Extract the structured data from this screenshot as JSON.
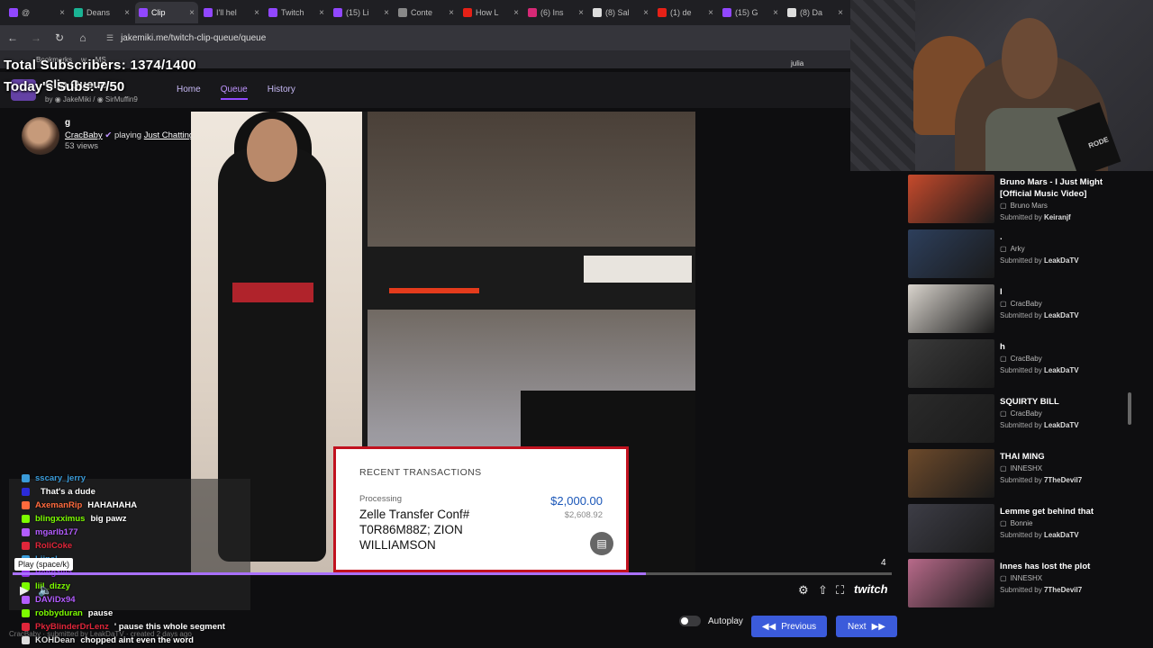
{
  "browser": {
    "tabs": [
      {
        "label": "@",
        "color": "#9147ff"
      },
      {
        "label": "Deans",
        "color": "#1ab394"
      },
      {
        "label": "Clip",
        "color": "#9147ff",
        "active": true
      },
      {
        "label": "I'll hel",
        "color": "#9147ff"
      },
      {
        "label": "Twitch",
        "color": "#9147ff"
      },
      {
        "label": "(15) Li",
        "color": "#9147ff"
      },
      {
        "label": "Conte",
        "color": "#888888"
      },
      {
        "label": "How L",
        "color": "#e62117"
      },
      {
        "label": "(6) Ins",
        "color": "#d62976"
      },
      {
        "label": "(8) Sal",
        "color": "#dddddd"
      },
      {
        "label": "(1) de",
        "color": "#e62117"
      },
      {
        "label": "(15) G",
        "color": "#9147ff"
      },
      {
        "label": "(8) Da",
        "color": "#dddddd"
      }
    ],
    "url": "jakemiki.me/twitch-clip-queue/queue",
    "bookmarks": [
      "Bookmarks",
      "w",
      "MS"
    ]
  },
  "overlay": {
    "subs": "Total Subscribers: 1374/1400",
    "today": "Today's Subs: 7/50"
  },
  "app": {
    "title": "Clip Queue",
    "by": "by",
    "authors": [
      "JakeMiki",
      "SirMuffin9"
    ],
    "nav": [
      {
        "label": "Home",
        "active": false
      },
      {
        "label": "Queue",
        "active": true
      },
      {
        "label": "History",
        "active": false
      }
    ],
    "user": "julia"
  },
  "clip": {
    "title": "g",
    "channel": "CracBaby",
    "playing": "playing",
    "game": "Just Chatting",
    "views": "53 views",
    "submitted": "CracBaby · submitted by LeakDaTV · created 2 days ago"
  },
  "transaction": {
    "heading": "RECENT TRANSACTIONS",
    "status": "Processing",
    "description": "Zelle Transfer Conf# T0R86M88Z; ZION WILLIAMSON",
    "amount": "$2,000.00",
    "balance": "$2,608.92"
  },
  "player": {
    "progress": 0.72,
    "time": "4",
    "tooltip": "Play (space/k)",
    "brand": "twitch"
  },
  "chat": [
    {
      "user": "sscary_jerry",
      "color": "#3a9bd9",
      "msg": ""
    },
    {
      "user": "",
      "color": "#2b2bd9",
      "msg": "That's a dude"
    },
    {
      "user": "AxemanRip",
      "color": "#ff6a3d",
      "msg": "HAHAHAHA"
    },
    {
      "user": "blingxximus",
      "color": "#7cfc00",
      "msg": "big pawz"
    },
    {
      "user": "mgarlb177",
      "color": "#b35cff",
      "msg": ""
    },
    {
      "user": "RoliCoke",
      "color": "#e0263a",
      "msg": ""
    },
    {
      "user": "Liinel",
      "color": "#3a9bd9",
      "msg": ""
    },
    {
      "user": "Pengzilla",
      "color": "#8a2be2",
      "msg": ""
    },
    {
      "user": "liil_dizzy",
      "color": "#7cfc00",
      "msg": ""
    },
    {
      "user": "DAViDx94",
      "color": "#b35cff",
      "msg": ""
    },
    {
      "user": "robbyduran",
      "color": "#7cfc00",
      "msg": "pause"
    },
    {
      "user": "PkyBlinderDrLenz",
      "color": "#e0263a",
      "msg": "' pause this whole segment"
    },
    {
      "user": "KOHDean",
      "color": "#dddddd",
      "msg": "chopped aint even the word"
    }
  ],
  "controls": {
    "autoplay": "Autoplay",
    "previous": "Previous",
    "next": "Next"
  },
  "queue": [
    {
      "title": "Bruno Mars - I Just Might [Official Music Video]",
      "channel": "Bruno Mars",
      "submitter": "Keiranjf",
      "thumb": "#c64a2c"
    },
    {
      "title": ".",
      "channel": "Arky",
      "submitter": "LeakDaTV",
      "thumb": "#2d3f5c"
    },
    {
      "title": "l",
      "channel": "CracBaby",
      "submitter": "LeakDaTV",
      "thumb": "#d9d4cd"
    },
    {
      "title": "h",
      "channel": "CracBaby",
      "submitter": "LeakDaTV",
      "thumb": "#3a3a3a"
    },
    {
      "title": "SQUIRTY BILL",
      "channel": "CracBaby",
      "submitter": "LeakDaTV",
      "thumb": "#2a2a2a"
    },
    {
      "title": "THAI MING",
      "channel": "INNESHX",
      "submitter": "7TheDevil7",
      "thumb": "#6d4a2b"
    },
    {
      "title": "Lemme get behind that",
      "channel": "Bonnie",
      "submitter": "LeakDaTV",
      "thumb": "#3d3d46"
    },
    {
      "title": "Innes has lost the plot",
      "channel": "INNESHX",
      "submitter": "7TheDevil7",
      "thumb": "#b86a8a"
    }
  ],
  "queue_labels": {
    "submitted_by": "Submitted by"
  },
  "camera": {
    "mic_brand": "RODE"
  }
}
